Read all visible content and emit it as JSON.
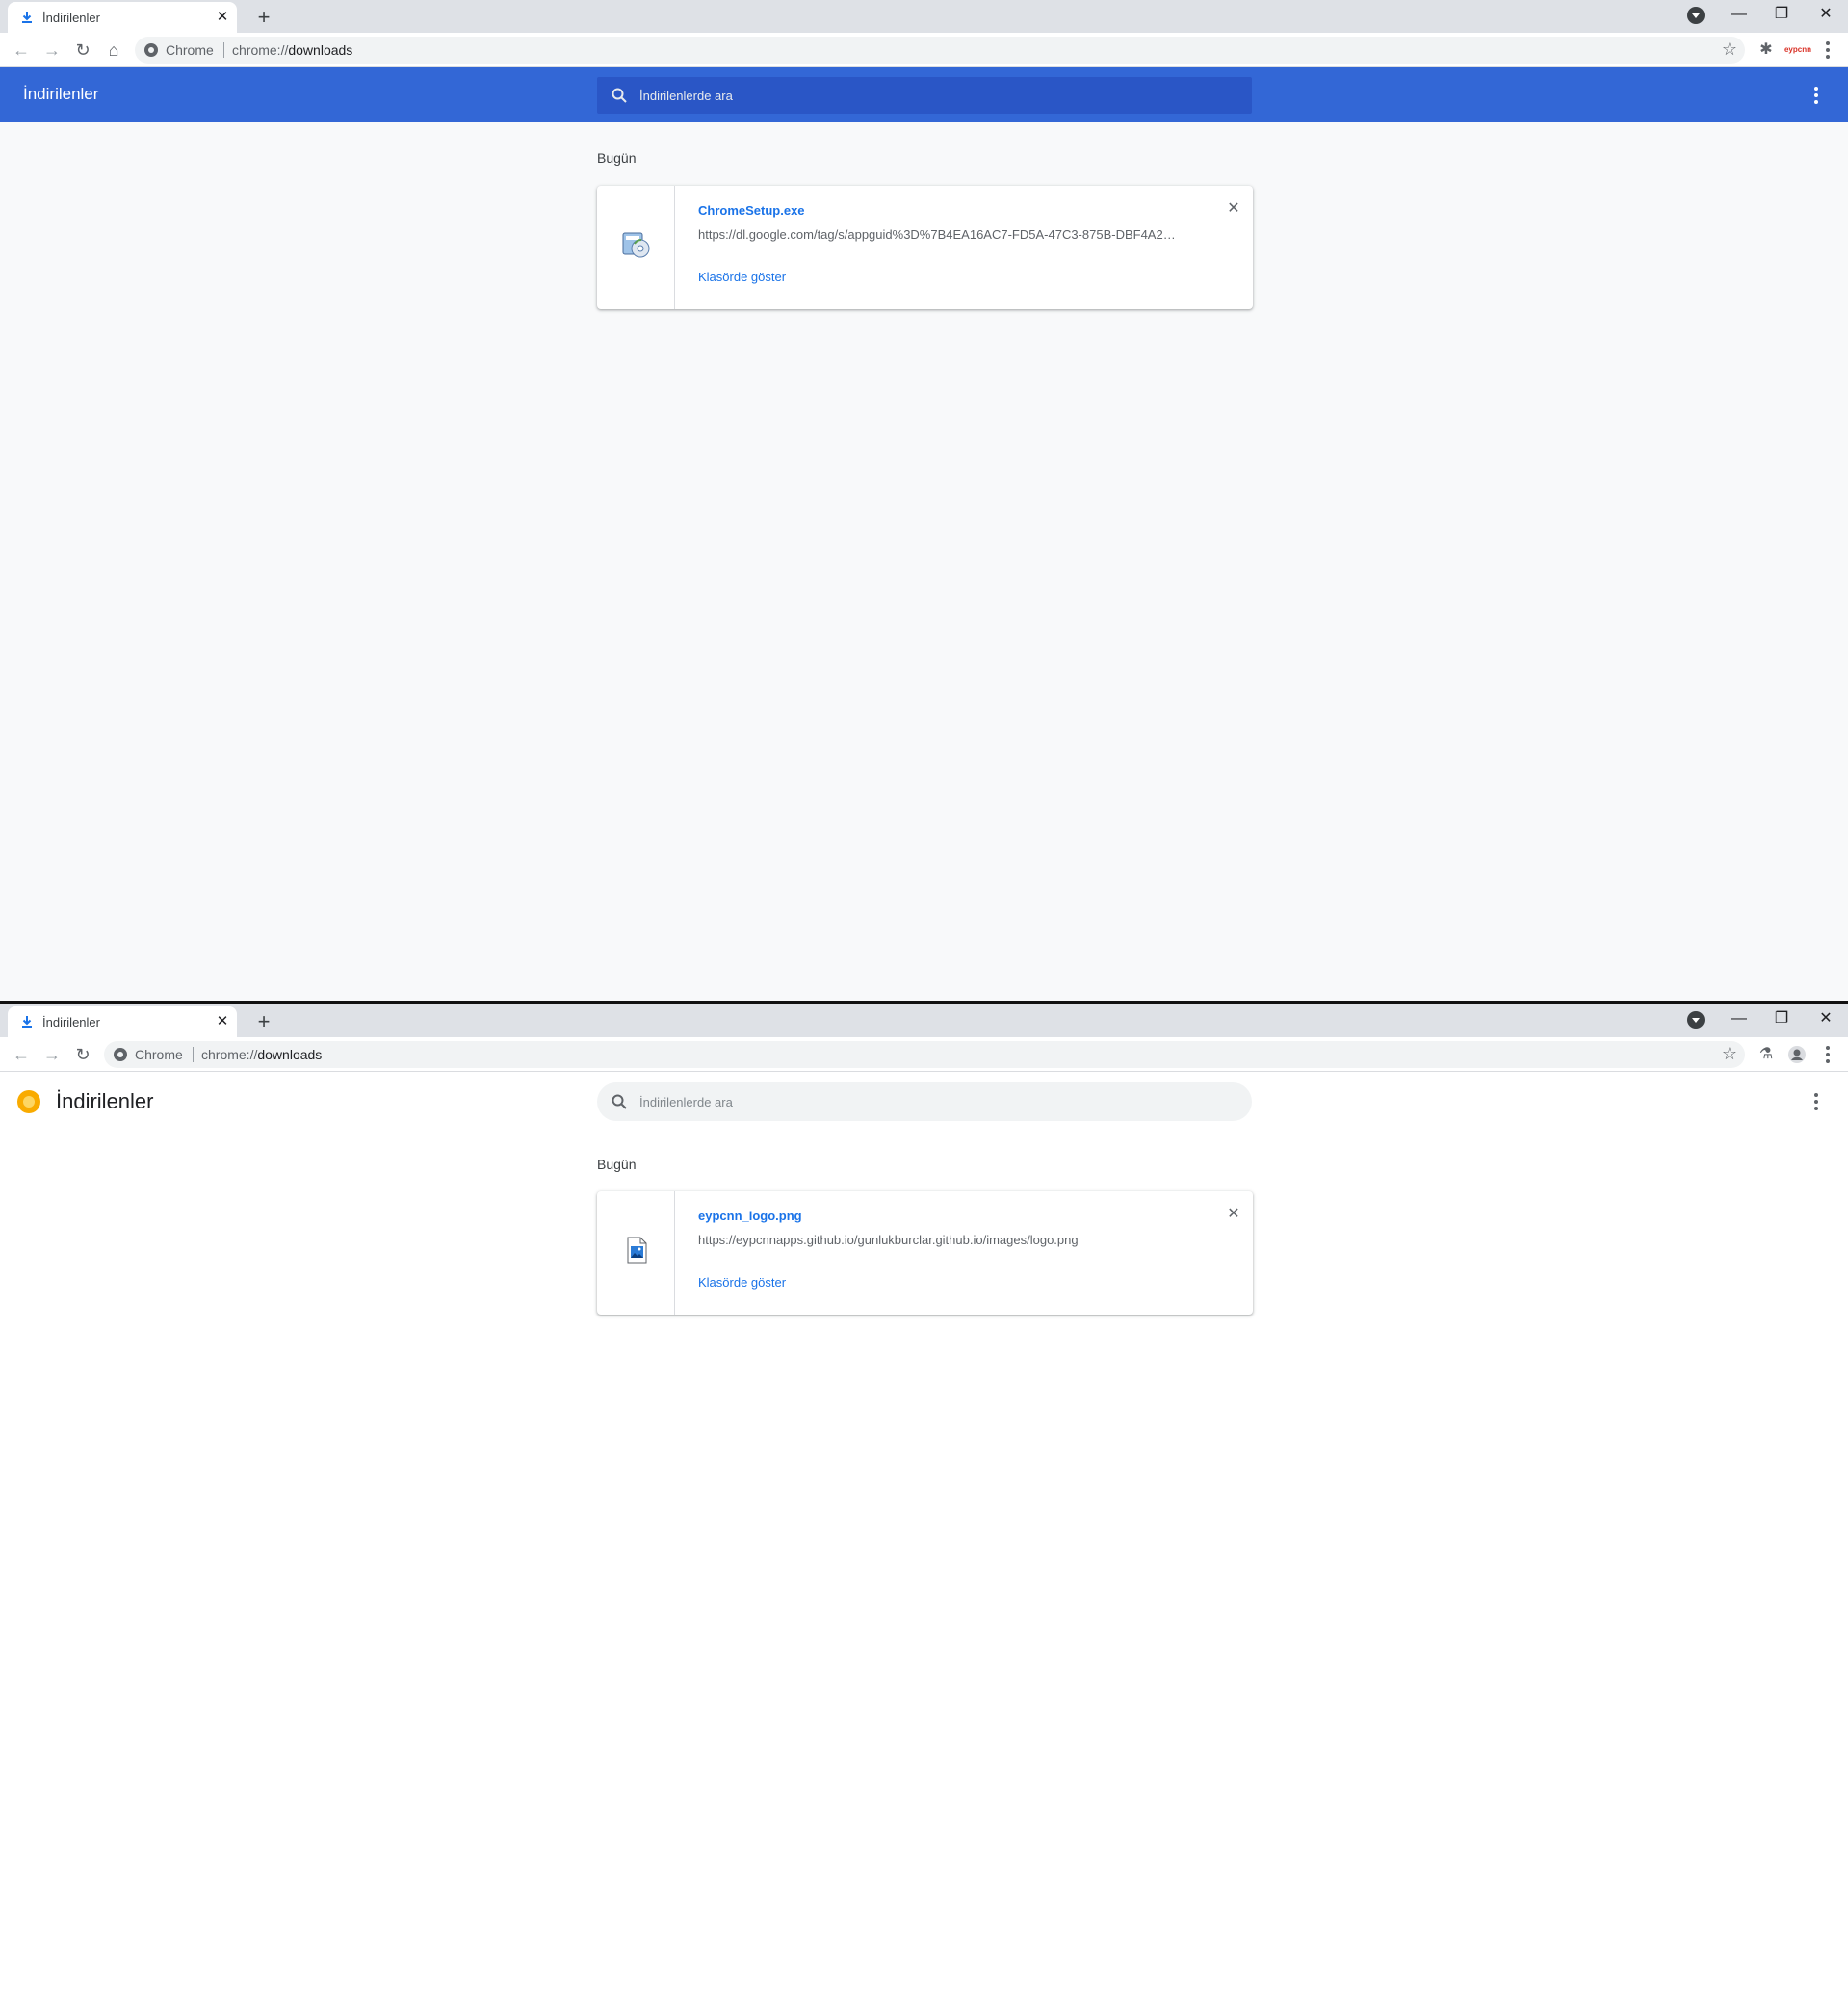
{
  "top": {
    "tab": {
      "title": "İndirilenler"
    },
    "omnibox": {
      "chip": "Chrome",
      "url_scheme": "chrome://",
      "url_path": "downloads"
    },
    "extension_label": "eypcnn",
    "page": {
      "title": "İndirilenler",
      "search_placeholder": "İndirilenlerde ara",
      "section": "Bugün",
      "download": {
        "name": "ChromeSetup.exe",
        "url": "https://dl.google.com/tag/s/appguid%3D%7B4EA16AC7-FD5A-47C3-875B-DBF4A20...",
        "action": "Klasörde göster",
        "icon": "installer-file-icon"
      }
    }
  },
  "bottom": {
    "tab": {
      "title": "İndirilenler"
    },
    "omnibox": {
      "chip": "Chrome",
      "url_scheme": "chrome://",
      "url_path": "downloads"
    },
    "page": {
      "title": "İndirilenler",
      "search_placeholder": "İndirilenlerde ara",
      "section": "Bugün",
      "download": {
        "name": "eypcnn_logo.png",
        "url": "https://eypcnnapps.github.io/gunlukburclar.github.io/images/logo.png",
        "action": "Klasörde göster",
        "icon": "image-file-icon"
      }
    }
  },
  "colors": {
    "accent": "#3367d6",
    "link": "#1a73e8",
    "page_bg": "#f8f9fa"
  }
}
